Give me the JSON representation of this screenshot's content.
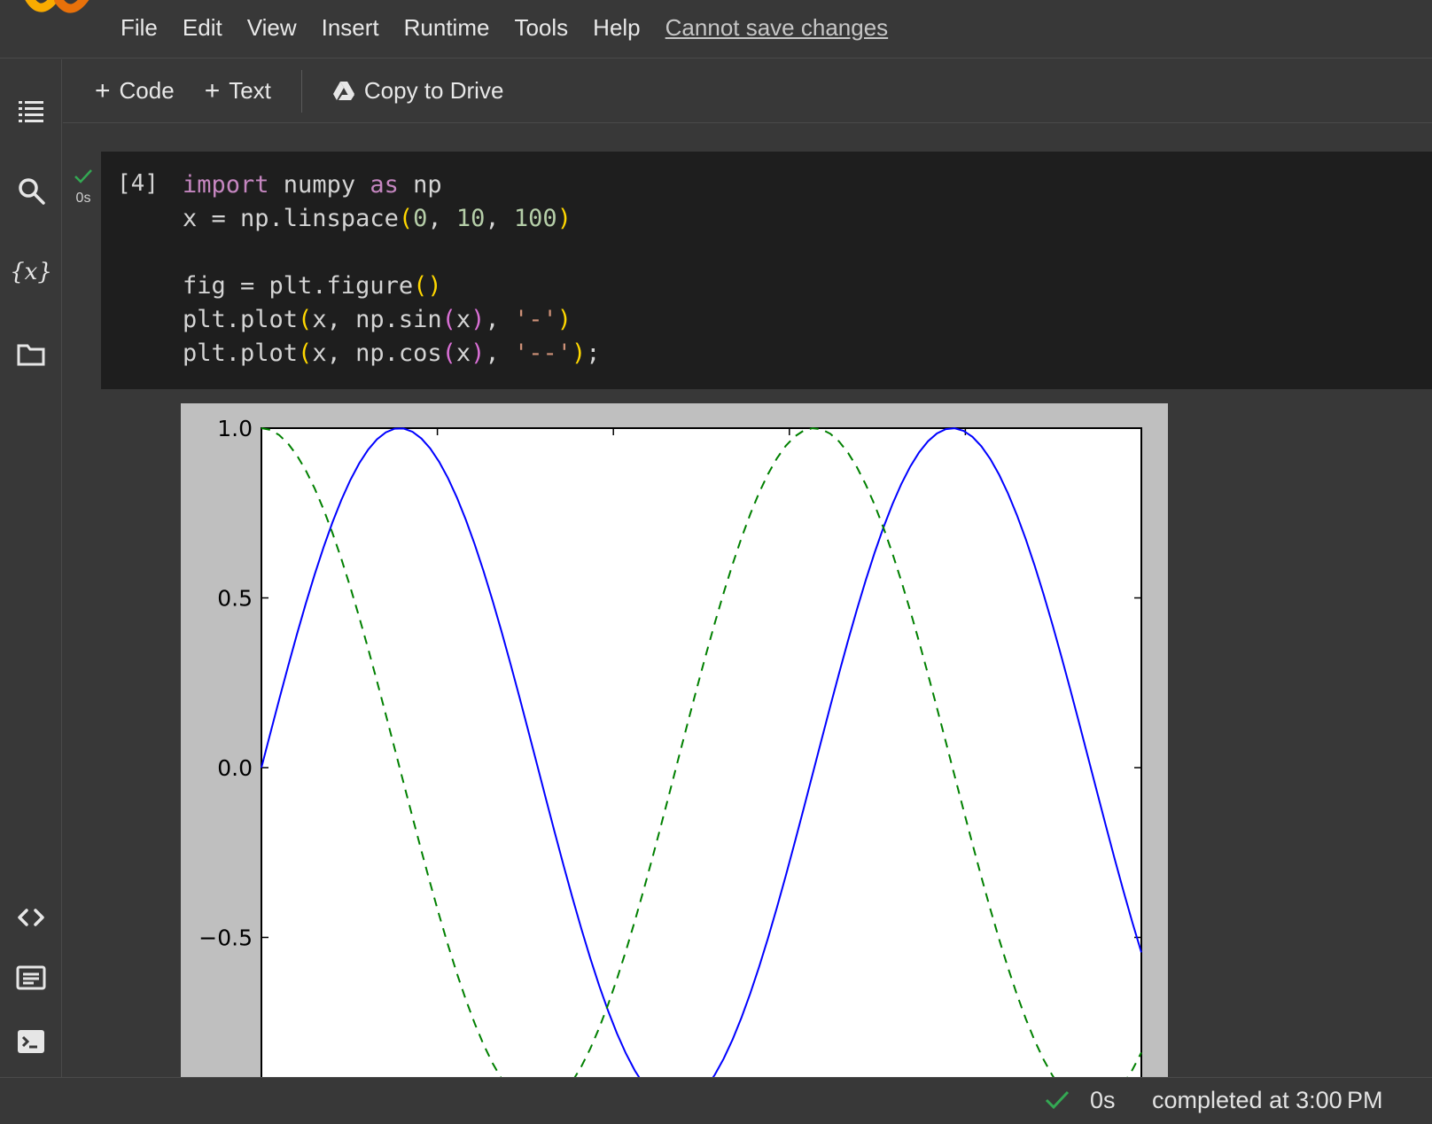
{
  "menubar": {
    "items": [
      "File",
      "Edit",
      "View",
      "Insert",
      "Runtime",
      "Tools",
      "Help"
    ],
    "save_status": "Cannot save changes"
  },
  "sidebar": {
    "icons": [
      "table-of-contents-icon",
      "search-icon",
      "variables-icon",
      "folder-icon",
      "code-snippets-icon",
      "command-palette-icon",
      "terminal-icon"
    ],
    "variables_label": "{x}"
  },
  "toolbar": {
    "add_code_label": "Code",
    "add_text_label": "Text",
    "copy_to_drive_label": "Copy to Drive"
  },
  "cell": {
    "execution_count": "[4]",
    "run_time": "0s",
    "code_lines": [
      "import numpy as np",
      "x = np.linspace(0, 10, 100)",
      "",
      "fig = plt.figure()",
      "plt.plot(x, np.sin(x), '-')",
      "plt.plot(x, np.cos(x), '--');"
    ]
  },
  "chart_data": {
    "type": "line",
    "x": {
      "start": 0,
      "end": 10,
      "count": 100
    },
    "xlim": [
      0,
      10
    ],
    "ylim": [
      -1.0,
      1.0
    ],
    "ytick_labels": [
      "1.0",
      "0.5",
      "0.0",
      "−0.5"
    ],
    "ytick_values": [
      1.0,
      0.5,
      0.0,
      -0.5
    ],
    "series": [
      {
        "function": "sin",
        "style": "solid",
        "color": "#0000ff"
      },
      {
        "function": "cos",
        "style": "dashed",
        "color": "#008000"
      }
    ],
    "visible_y_min": -0.92
  },
  "statusbar": {
    "time": "0s",
    "text": "completed at 3:00 PM"
  }
}
